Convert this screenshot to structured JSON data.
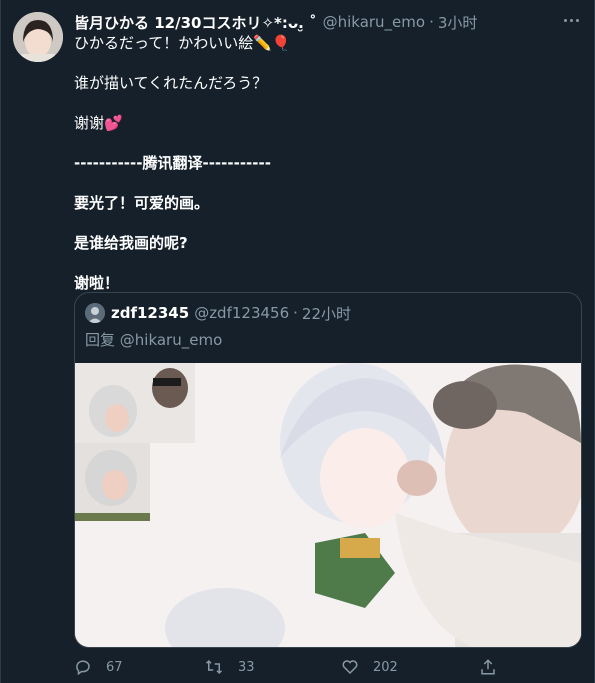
{
  "tweet": {
    "display_name": "皆月ひかる 12/30コスホリ✧*:ᴗ.̮ ˚",
    "handle": "@hikaru_emo",
    "separator": "·",
    "time": "3小时",
    "lines": [
      "ひかるだって！かわいい絵✏️🎈",
      "",
      "谁が描いてくれたんだろう？",
      "",
      "谢谢💕",
      "",
      "-----------腾讯翻译-----------",
      "",
      "要光了！可爱的画。",
      "",
      "是谁给我画的呢?",
      "",
      "谢啦！"
    ]
  },
  "quote": {
    "name": "zdf12345",
    "handle": "@zdf123456",
    "separator": "·",
    "time": "22小时",
    "reply_to": "回复 @hikaru_emo",
    "image_description_icon": "anime-cosplay-comparison-image"
  },
  "actions": {
    "reply_count": "67",
    "retweet_count": "33",
    "like_count": "202"
  },
  "colors": {
    "background": "#15202b",
    "secondary_text": "#8899a6",
    "border": "#38444d"
  }
}
